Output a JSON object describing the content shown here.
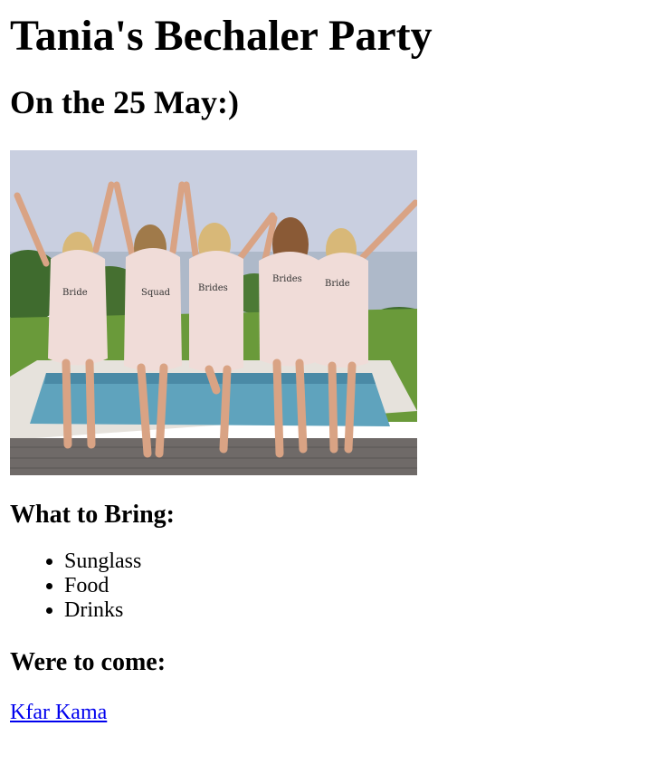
{
  "page": {
    "title": "Tania's Bechaler Party",
    "date_heading": "On the 25 May:)"
  },
  "photo": {
    "icon": "bridal-party-photo",
    "colors": {
      "sky": "#c9cfe0",
      "grass": "#6a9a3a",
      "pool": "#5fa3bd",
      "deck": "#6f6a68",
      "robe": "#f0dcd8"
    }
  },
  "bring": {
    "heading": "What to Bring:",
    "items": [
      "Sunglass",
      "Food",
      "Drinks"
    ]
  },
  "location": {
    "heading": "Were to come:",
    "link_text": "Kfar Kama",
    "link_color": "#0000ee"
  }
}
